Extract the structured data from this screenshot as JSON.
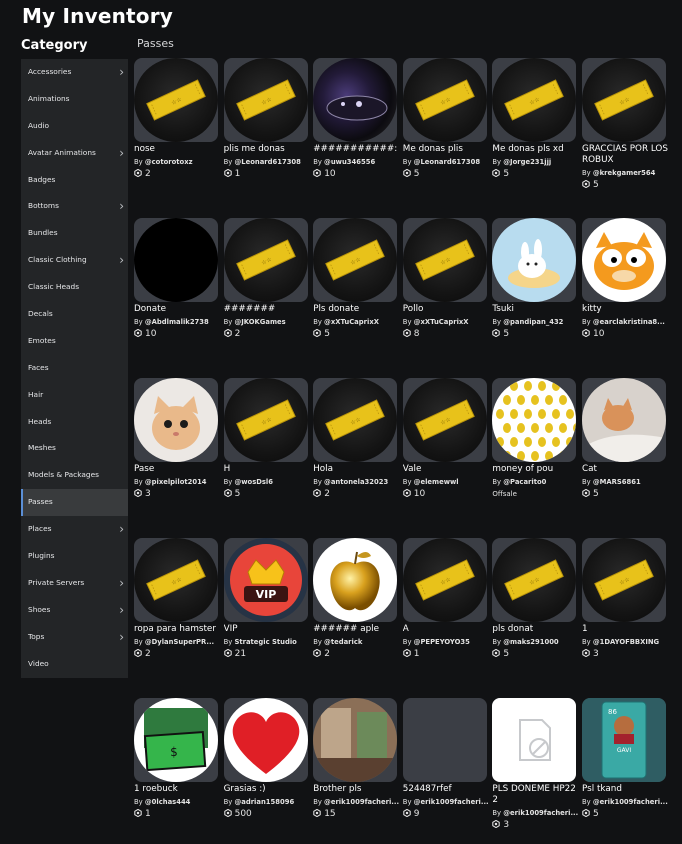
{
  "page": {
    "title": "My Inventory",
    "category_heading": "Category",
    "section_label": "Passes"
  },
  "sidebar": {
    "items": [
      {
        "label": "Accessories",
        "chevron": true
      },
      {
        "label": "Animations",
        "chevron": false
      },
      {
        "label": "Audio",
        "chevron": false
      },
      {
        "label": "Avatar Animations",
        "chevron": true
      },
      {
        "label": "Badges",
        "chevron": false
      },
      {
        "label": "Bottoms",
        "chevron": true
      },
      {
        "label": "Bundles",
        "chevron": false
      },
      {
        "label": "Classic Clothing",
        "chevron": true
      },
      {
        "label": "Classic Heads",
        "chevron": false
      },
      {
        "label": "Decals",
        "chevron": false
      },
      {
        "label": "Emotes",
        "chevron": false
      },
      {
        "label": "Faces",
        "chevron": false
      },
      {
        "label": "Hair",
        "chevron": false
      },
      {
        "label": "Heads",
        "chevron": false
      },
      {
        "label": "Meshes",
        "chevron": false
      },
      {
        "label": "Models & Packages",
        "chevron": false
      },
      {
        "label": "Passes",
        "chevron": false,
        "active": true
      },
      {
        "label": "Places",
        "chevron": true
      },
      {
        "label": "Plugins",
        "chevron": false
      },
      {
        "label": "Private Servers",
        "chevron": true
      },
      {
        "label": "Shoes",
        "chevron": true
      },
      {
        "label": "Tops",
        "chevron": true
      },
      {
        "label": "Video",
        "chevron": false
      }
    ]
  },
  "colors": {
    "accent": "#5b8fd6",
    "ticket": "#e8c21a",
    "sidebar_bg": "#232527",
    "page_bg": "#111214"
  },
  "icons": {
    "price": "robux-icon",
    "chevron": "chevron-right-icon"
  },
  "items": [
    {
      "name": "nose",
      "by_prefix": "By",
      "creator": "@cotorotoxz",
      "price": "2",
      "thumb": "pass"
    },
    {
      "name": "plis me donas",
      "by_prefix": "By",
      "creator": "@Leonard617308",
      "price": "1",
      "thumb": "pass"
    },
    {
      "name": "###########:",
      "by_prefix": "By",
      "creator": "@uwu346556",
      "price": "10",
      "thumb": "photo-dark"
    },
    {
      "name": "Me donas plis",
      "by_prefix": "By",
      "creator": "@Leonard617308",
      "price": "5",
      "thumb": "pass"
    },
    {
      "name": "Me donas pls xd",
      "by_prefix": "By",
      "creator": "@Jorge231jjj",
      "price": "5",
      "thumb": "pass"
    },
    {
      "name": "GRACCIAS POR LOS ROBUX",
      "by_prefix": "By",
      "creator": "@krekgamer564",
      "price": "5",
      "thumb": "pass"
    },
    {
      "name": "Donate",
      "by_prefix": "By",
      "creator": "@Abdlmalik2738",
      "price": "10",
      "thumb": "black"
    },
    {
      "name": "#######",
      "by_prefix": "By",
      "creator": "@JKOKGames",
      "price": "2",
      "thumb": "pass"
    },
    {
      "name": "Pls donate",
      "by_prefix": "By",
      "creator": "@xXTuCaprixX",
      "price": "5",
      "thumb": "pass"
    },
    {
      "name": "Pollo",
      "by_prefix": "By",
      "creator": "@xXTuCaprixX",
      "price": "8",
      "thumb": "pass"
    },
    {
      "name": "Tsuki",
      "by_prefix": "By",
      "creator": "@pandipan_432",
      "price": "5",
      "thumb": "bunny"
    },
    {
      "name": "kitty",
      "by_prefix": "By",
      "creator": "@earclakristina8...",
      "price": "10",
      "thumb": "garfield"
    },
    {
      "name": "Pase",
      "by_prefix": "By",
      "creator": "@pixelpilot2014",
      "price": "3",
      "thumb": "kitten"
    },
    {
      "name": "H",
      "by_prefix": "By",
      "creator": "@wosDsl6",
      "price": "5",
      "thumb": "pass"
    },
    {
      "name": "Hola",
      "by_prefix": "By",
      "creator": "@antonela32023",
      "price": "2",
      "thumb": "pass"
    },
    {
      "name": "Vale",
      "by_prefix": "By",
      "creator": "@elemewwl",
      "price": "10",
      "thumb": "pass"
    },
    {
      "name": "money of pou",
      "by_prefix": "By",
      "creator": "@Pacarito0",
      "price": "Offsale",
      "offsale": true,
      "thumb": "coins"
    },
    {
      "name": "Cat",
      "by_prefix": "By",
      "creator": "@MARS6861",
      "price": "5",
      "thumb": "cat"
    },
    {
      "name": "ropa para hamster",
      "by_prefix": "By",
      "creator": "@DylanSuperPR...",
      "price": "2",
      "thumb": "pass"
    },
    {
      "name": "VIP",
      "by_prefix": "By",
      "creator": "Strategic Studio",
      "price": "21",
      "thumb": "vip"
    },
    {
      "name": "###### aple",
      "by_prefix": "By",
      "creator": "@tedarick",
      "price": "2",
      "thumb": "apple"
    },
    {
      "name": "A",
      "by_prefix": "By",
      "creator": "@PEPEYOYO35",
      "price": "1",
      "thumb": "pass"
    },
    {
      "name": "pls donat",
      "by_prefix": "By",
      "creator": "@maks291000",
      "price": "5",
      "thumb": "pass"
    },
    {
      "name": "1",
      "by_prefix": "By",
      "creator": "@1DAYOFBBXING",
      "price": "3",
      "thumb": "pass"
    },
    {
      "name": "1 roebuck",
      "by_prefix": "By",
      "creator": "@0lchas444",
      "price": "1",
      "thumb": "money"
    },
    {
      "name": "Grasias :)",
      "by_prefix": "By",
      "creator": "@adrian158096",
      "price": "500",
      "thumb": "heart"
    },
    {
      "name": "Brother pls",
      "by_prefix": "By",
      "creator": "@erik1009facheri...",
      "price": "15",
      "thumb": "room"
    },
    {
      "name": "524487rfef",
      "by_prefix": "By",
      "creator": "@erik1009facheri...",
      "price": "9",
      "thumb": "empty"
    },
    {
      "name": "PLS DONEME HP222",
      "by_prefix": "By",
      "creator": "@erik1009facheri...",
      "price": "3",
      "thumb": "unavailable"
    },
    {
      "name": "Psl tkand",
      "by_prefix": "By",
      "creator": "@erik1009facheri...",
      "price": "5",
      "thumb": "card"
    }
  ]
}
